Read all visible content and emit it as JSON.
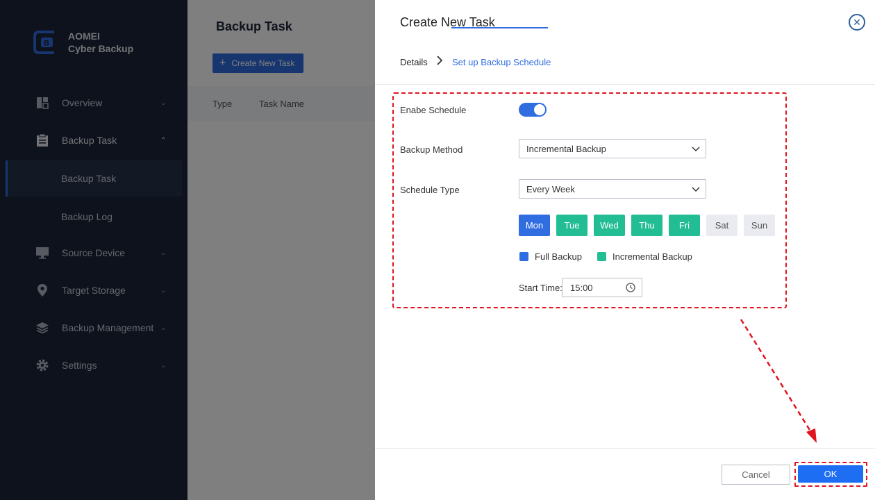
{
  "app": {
    "name_line1": "AOMEI",
    "name_line2": "Cyber Backup"
  },
  "sidebar": {
    "items": [
      {
        "label": "Overview",
        "icon": "overview-icon"
      },
      {
        "label": "Backup Task",
        "icon": "clipboard-icon",
        "expanded": true
      },
      {
        "label": "Backup Task",
        "sub": true,
        "active": true
      },
      {
        "label": "Backup Log",
        "sub": true
      },
      {
        "label": "Source Device",
        "icon": "monitor-icon"
      },
      {
        "label": "Target Storage",
        "icon": "location-pin-icon"
      },
      {
        "label": "Backup Management",
        "icon": "layers-icon"
      },
      {
        "label": "Settings",
        "icon": "gear-icon"
      }
    ]
  },
  "main": {
    "title": "Backup Task",
    "create_button": "Create New Task",
    "table_columns": [
      "Type",
      "Task Name"
    ]
  },
  "drawer": {
    "title": "Create New Task",
    "steps": [
      "Details",
      "Set up Backup Schedule"
    ],
    "form": {
      "enable_schedule_label": "Enabe Schedule",
      "enable_schedule_on": true,
      "backup_method_label": "Backup Method",
      "backup_method_value": "Incremental Backup",
      "schedule_type_label": "Schedule Type",
      "schedule_type_value": "Every Week",
      "days": [
        {
          "label": "Mon",
          "state": "full"
        },
        {
          "label": "Tue",
          "state": "incremental"
        },
        {
          "label": "Wed",
          "state": "incremental"
        },
        {
          "label": "Thu",
          "state": "incremental"
        },
        {
          "label": "Fri",
          "state": "incremental"
        },
        {
          "label": "Sat",
          "state": "off"
        },
        {
          "label": "Sun",
          "state": "off"
        }
      ],
      "legend": [
        {
          "label": "Full Backup",
          "color": "#2f6de0"
        },
        {
          "label": "Incremental Backup",
          "color": "#23bd94"
        }
      ],
      "start_time_label": "Start Time:",
      "start_time_value": "15:00"
    },
    "cancel_label": "Cancel",
    "ok_label": "OK"
  },
  "colors": {
    "accent": "#2f6de0",
    "incremental": "#23bd94",
    "highlight": "#e0141e",
    "sidebar_bg": "#1d2538"
  }
}
